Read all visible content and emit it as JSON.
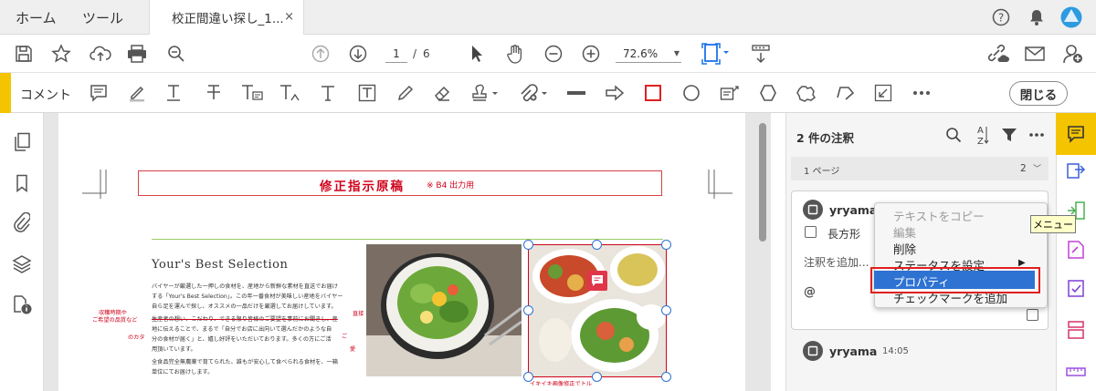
{
  "tabs": {
    "home": "ホーム",
    "tools": "ツール",
    "doc_title": "校正間違い探し_1...",
    "close": "×"
  },
  "toolbar": {
    "page_current": "1",
    "page_sep": "/",
    "page_total": "6",
    "zoom": "72.6%"
  },
  "comment_toolbar": {
    "title": "コメント",
    "close_label": "閉じる"
  },
  "document": {
    "title": "修正指示原稿",
    "subtitle": "※ B4 出力用",
    "heading": "Your's Best Selection",
    "body": [
      "バイヤーが厳選した一押しの食材を、産地から新鮮な素材を直送でお届け",
      "する「Your's Best Selection」。この年一番食材が美味しい産地をバイヤー",
      "自ら足を運んで探し、オススメの一品だけを厳選してお届けしています。",
      "生産者の想い、こだわり、できる限り皆様のご要望を事前にお聞きし、産",
      "地に伝えることで、まるで「自分でお店に出向いて選んだかのような自",
      "分の食材が届く」と、嬉し好評をいただいております。多くの方にご活",
      "用頂いています。",
      "全食品完全無農薬で育てられた、誰もが安心して食べられる食材を、一箱",
      "単位にてお届けします。"
    ],
    "annotations": {
      "a1": "収穫時期や",
      "a2": "ご希望の品質など",
      "a3": "のカタ",
      "a4": "直接",
      "a5": "ご",
      "a6": "愛",
      "a7": "イキイキ画像修正でトル"
    }
  },
  "comments_panel": {
    "count_label": "2 件の注釈",
    "page_label": "1 ページ",
    "page_count": "2",
    "card": {
      "user": "yryama",
      "shape": "長方形",
      "reply_placeholder": "注釈を追加...",
      "mention": "@"
    },
    "second": {
      "user": "yryama",
      "time": "14:05"
    }
  },
  "context_menu": {
    "items": [
      "テキストをコピー",
      "編集",
      "削除",
      "ステータスを設定",
      "プロパティ",
      "チェックマークを追加"
    ],
    "submenu_arrow": "▶",
    "selected": "プロパティ"
  },
  "tooltip": "メニュー",
  "colors": {
    "accent": "#f5c400",
    "blue": "#2e72d2",
    "red": "#e02020",
    "doc_red": "#d0021b"
  }
}
